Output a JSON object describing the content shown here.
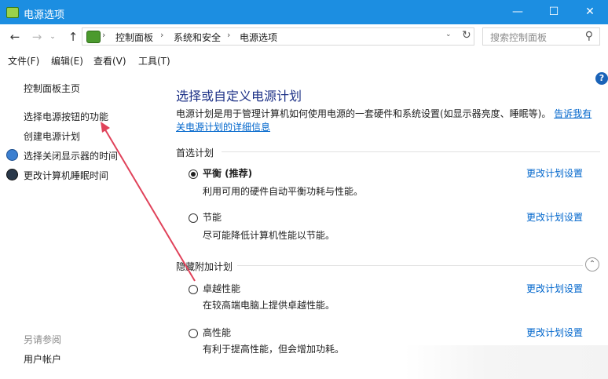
{
  "window": {
    "title": "电源选项",
    "btn_min": "—",
    "btn_max": "☐",
    "btn_close": "✕"
  },
  "nav": {
    "back": "←",
    "forward": "→",
    "recent": "⌄",
    "up": "↑",
    "breadcrumb": [
      "控制面板",
      "系统和安全",
      "电源选项"
    ],
    "separator": "›",
    "dropdown": "⌄",
    "refresh": "↻",
    "search_placeholder": "搜索控制面板",
    "search_icon": "⚲"
  },
  "menu": [
    "文件(F)",
    "编辑(E)",
    "查看(V)",
    "工具(T)"
  ],
  "sidebar": {
    "home": "控制面板主页",
    "links": [
      "选择电源按钮的功能",
      "创建电源计划",
      "选择关闭显示器的时间",
      "更改计算机睡眠时间"
    ],
    "see_also_title": "另请参阅",
    "see_also": [
      "用户帐户"
    ]
  },
  "main": {
    "heading": "选择或自定义电源计划",
    "description": "电源计划是用于管理计算机如何使用电源的一套硬件和系统设置(如显示器亮度、睡眠等)。",
    "learn_more": "告诉我有关电源计划的详细信息",
    "preferred_title": "首选计划",
    "hidden_title": "隐藏附加计划",
    "collapse": "⌃",
    "help": "?",
    "plans": [
      {
        "name": "平衡 (推荐)",
        "desc": "利用可用的硬件自动平衡功耗与性能。",
        "link": "更改计划设置",
        "selected": true
      },
      {
        "name": "节能",
        "desc": "尽可能降低计算机性能以节能。",
        "link": "更改计划设置",
        "selected": false
      },
      {
        "name": "卓越性能",
        "desc": "在较高端电脑上提供卓越性能。",
        "link": "更改计划设置",
        "selected": false
      },
      {
        "name": "高性能",
        "desc": "有利于提高性能，但会增加功耗。",
        "link": "更改计划设置",
        "selected": false
      }
    ]
  },
  "colors": {
    "title_bar": "#1c8ee1",
    "heading": "#1e3287",
    "link": "#0066cc",
    "annotation_arrow": "#e0425a"
  }
}
